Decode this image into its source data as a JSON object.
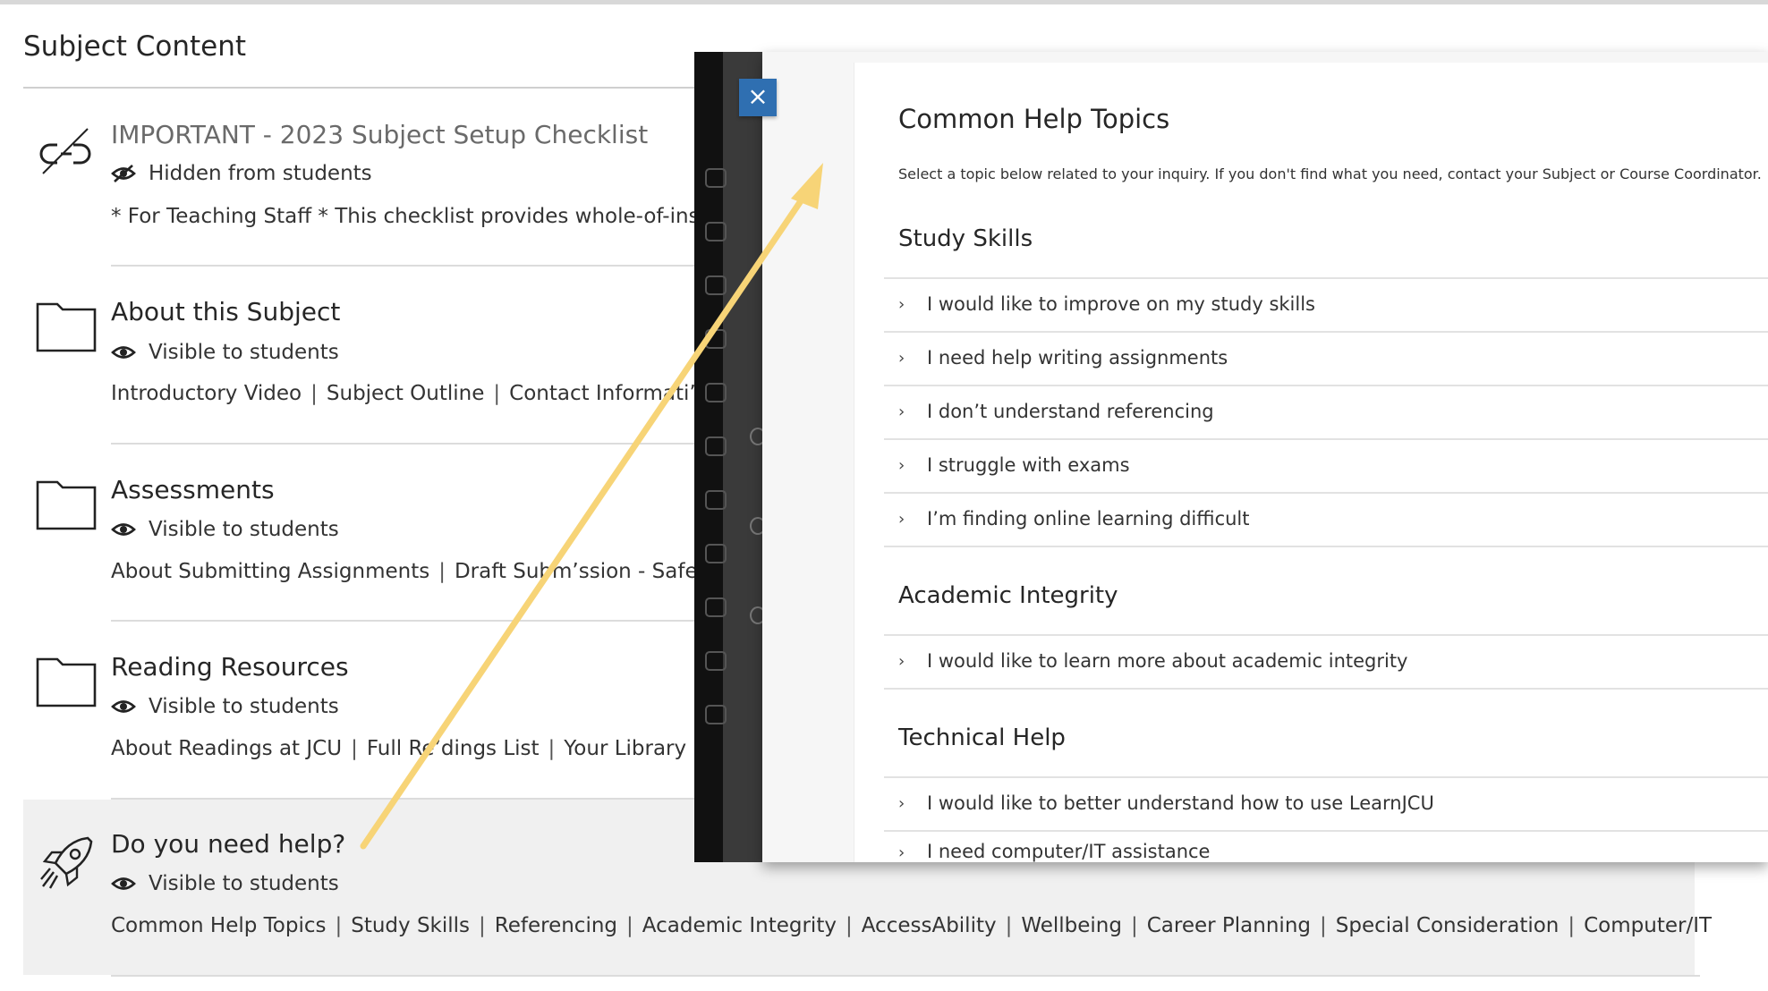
{
  "page": {
    "title": "Subject Content"
  },
  "items": [
    {
      "title": "IMPORTANT - 2023 Subject Setup Checklist",
      "icon": "broken-link-icon",
      "visibility": "Hidden from students",
      "description": "* For Teaching Staff * This checklist provides whole-of-instit"
    },
    {
      "title": "About this Subject",
      "icon": "folder-icon",
      "visibility": "Visible to students",
      "links": [
        "Introductory Video",
        "Subject Outline",
        "Contact Informati’n"
      ]
    },
    {
      "title": "Assessments",
      "icon": "folder-icon",
      "visibility": "Visible to students",
      "links": [
        "About Submitting Assignments",
        "Draft Subm’ssion - SafeAss"
      ]
    },
    {
      "title": "Reading Resources",
      "icon": "folder-icon",
      "visibility": "Visible to students",
      "links": [
        "About Readings at JCU",
        "Full Re’dings List",
        "Your Library"
      ]
    },
    {
      "title": "Do you need help?",
      "icon": "rocket-icon",
      "visibility": "Visible to students",
      "links": [
        "Common Help Topics",
        "Study Skills",
        "Referencing",
        "Academic Integrity",
        "AccessAbility",
        "Wellbeing",
        "Career Planning",
        "Special Consideration",
        "Computer/IT"
      ]
    }
  ],
  "modal": {
    "close_label": "×",
    "heading": "Common Help Topics",
    "description": "Select a topic below related to your inquiry. If you don't find what you need, contact your Subject or Course Coordinator.",
    "sections": [
      {
        "title": "Study Skills",
        "topics": [
          "I would like to improve on my study skills",
          "I need help writing assignments",
          "I don’t understand referencing",
          "I struggle with exams",
          "I’m finding online learning difficult"
        ]
      },
      {
        "title": "Academic Integrity",
        "topics": [
          "I would like to learn more about academic integrity"
        ]
      },
      {
        "title": "Technical Help",
        "topics": [
          "I would like to better understand how to use LearnJCU",
          "I need computer/IT assistance"
        ]
      }
    ]
  },
  "colors": {
    "arrow": "#f7d477",
    "close_button": "#2f6fb1",
    "help_band": "#f0f0f0",
    "sidebar_dark": "#3a3a3a"
  }
}
